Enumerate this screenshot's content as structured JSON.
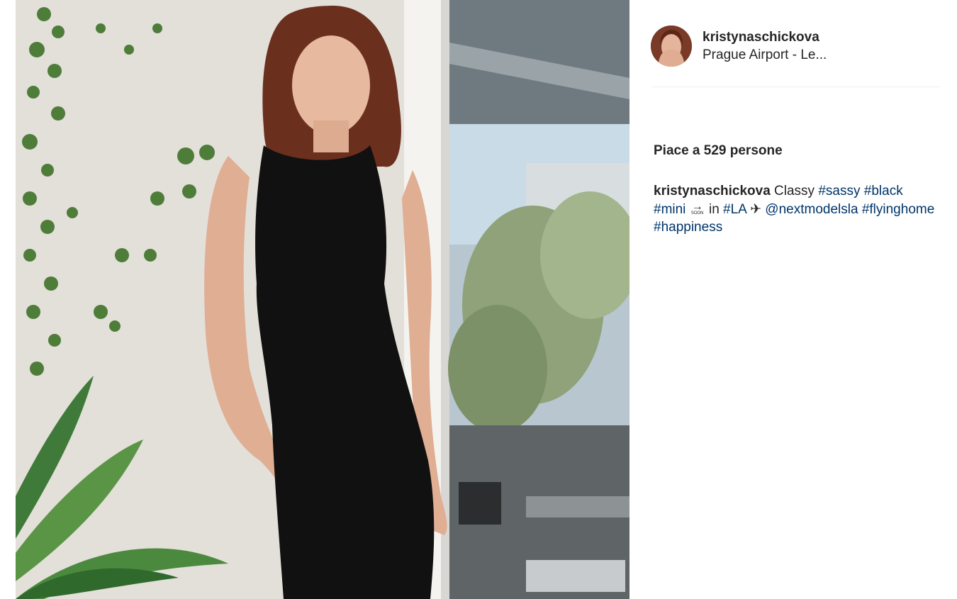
{
  "post": {
    "username": "kristynaschickova",
    "location": "Prague Airport - Le...",
    "likes_text": "Piace a 529 persone",
    "caption": {
      "user": "kristynaschickova",
      "text_classy": "Classy",
      "tag_sassy": "#sassy",
      "tag_black": "#black",
      "tag_mini": "#mini",
      "soon_arrow": "→",
      "soon_label": "SOON",
      "text_in": "in",
      "tag_la": "#LA",
      "plane": "✈",
      "mention": "@nextmodelsla",
      "tag_flyinghome": "#flyinghome",
      "tag_happiness": "#happiness"
    }
  },
  "colors": {
    "text": "#262626",
    "link": "#003569",
    "divider": "#efefef"
  },
  "icons": {
    "avatar": "profile-photo",
    "soon_emoji": "soon-arrow-icon",
    "plane_emoji": "airplane-icon"
  }
}
